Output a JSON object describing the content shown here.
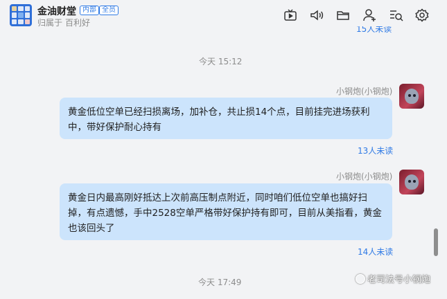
{
  "header": {
    "group_name": "金油财堂",
    "badge_internal": "内部",
    "badge_member": "全员",
    "owner_label": "归属于",
    "owner_org": "百利好"
  },
  "toolbar": {
    "icons": [
      "video-icon",
      "voice-icon",
      "folder-icon",
      "add-member-icon",
      "search-messages-icon",
      "settings-icon"
    ]
  },
  "top_unread": "15人未读",
  "messages": [
    {
      "time": "今天 15:12",
      "sender": "小钢炮(小钢炮)",
      "text": "黄金低位空单已经扫损离场，加补仓，共止损14个点，目前挂完进场获利中，带好保护耐心持有",
      "unread": "13人未读"
    },
    {
      "sender": "小钢炮(小钢炮)",
      "text": "黄金日内最高刚好抵达上次前高压制点附近，同时咱们低位空单也搞好扫掉，有点遗憾，手中2528空单严格带好保护持有即可，目前从美指看，黄金也该回头了",
      "unread": "14人未读"
    }
  ],
  "time_bottom": "今天 17:49",
  "watermark": "老司法号小钢炮",
  "colors": {
    "accent": "#2f7ae5",
    "bubble": "#cce4fc",
    "background": "#f2f3f5"
  }
}
